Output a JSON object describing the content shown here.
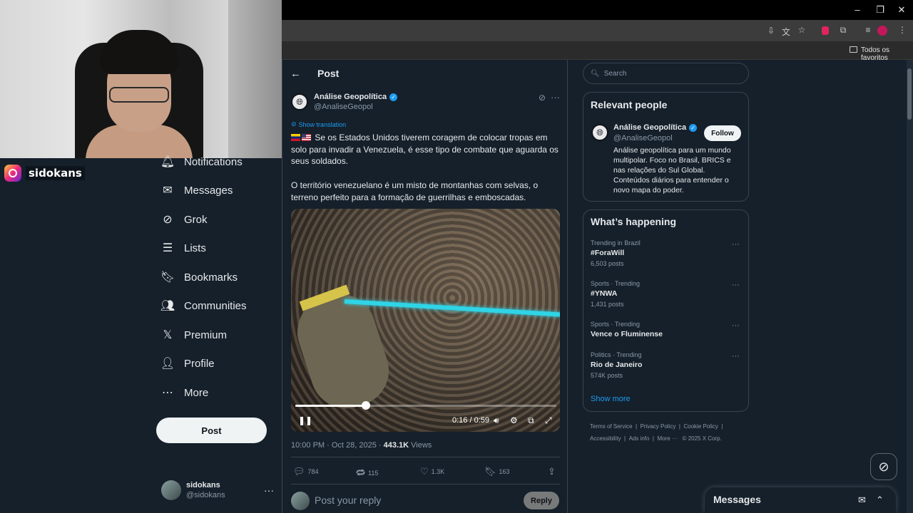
{
  "browser": {
    "toolbar_icons": [
      "install-icon",
      "translate-icon",
      "star-icon",
      "extension-red-icon",
      "puzzle-icon",
      "media-icon",
      "profile-icon",
      "kebab-icon"
    ],
    "bookmarks_label": "Todos os favoritos",
    "window_controls": {
      "minimize": "–",
      "restore": "❐",
      "close": "✕"
    }
  },
  "stream": {
    "instagram_handle": "sidokans"
  },
  "nav": {
    "items": [
      {
        "label": "Notifications",
        "icon": "bell-icon"
      },
      {
        "label": "Messages",
        "icon": "envelope-icon"
      },
      {
        "label": "Grok",
        "icon": "grok-icon"
      },
      {
        "label": "Lists",
        "icon": "list-icon"
      },
      {
        "label": "Bookmarks",
        "icon": "bookmark-icon"
      },
      {
        "label": "Communities",
        "icon": "people-icon"
      },
      {
        "label": "Premium",
        "icon": "x-logo-icon"
      },
      {
        "label": "Profile",
        "icon": "person-icon"
      },
      {
        "label": "More",
        "icon": "more-circle-icon"
      }
    ],
    "post_button": "Post",
    "account": {
      "name": "sidokans",
      "handle": "@sidokans"
    }
  },
  "post": {
    "heading": "Post",
    "author_name": "Análise Geopolítica",
    "author_handle": "@AnaliseGeopol",
    "show_translation": "Show translation",
    "paragraph1": "Se os Estados Unidos tiverem coragem de colocar tropas em solo para invadir a Venezuela, é esse tipo de combate que aguarda os seus soldados.",
    "paragraph2": "O território venezuelano é um misto de montanhas com selvas, o terreno perfeito para a formação de guerrilhas e emboscadas.",
    "video": {
      "time": "0:16 / 0:59",
      "progress": 0.27
    },
    "timestamp": "10:00 PM · Oct 28, 2025 · ",
    "views_count": "443.1K",
    "views_label": " Views",
    "stats": {
      "replies": "784",
      "reposts": "115",
      "likes": "1.3K",
      "bookmarks": "163"
    },
    "reply_placeholder": "Post your reply",
    "reply_button": "Reply"
  },
  "sidebar": {
    "search_placeholder": "Search",
    "relevant_title": "Relevant people",
    "person": {
      "name": "Análise Geopolítica",
      "handle": "@AnaliseGeopol",
      "follow": "Follow",
      "bio": "Análise geopolítica para um mundo multipolar. Foco no Brasil, BRICS e nas relações do Sul Global. Conteúdos diários para entender o novo mapa do poder."
    },
    "happening_title": "What’s happening",
    "trends": [
      {
        "context": "Trending in Brazil",
        "name": "#ForaWill",
        "count": "6,503 posts"
      },
      {
        "context": "Sports · Trending",
        "name": "#YNWA",
        "count": "1,431 posts"
      },
      {
        "context": "Sports · Trending",
        "name": "Vence o Fluminense",
        "count": ""
      },
      {
        "context": "Politics · Trending",
        "name": "Rio de Janeiro",
        "count": "574K posts"
      }
    ],
    "show_more": "Show more",
    "footer_line1": [
      "Terms of Service",
      "|",
      "Privacy Policy",
      "|",
      "Cookie Policy",
      "|"
    ],
    "footer_line2": [
      "Accessibility",
      "|",
      "Ads info",
      "|",
      "More ···",
      "© 2025 X Corp."
    ]
  },
  "messages_drawer": {
    "title": "Messages"
  }
}
